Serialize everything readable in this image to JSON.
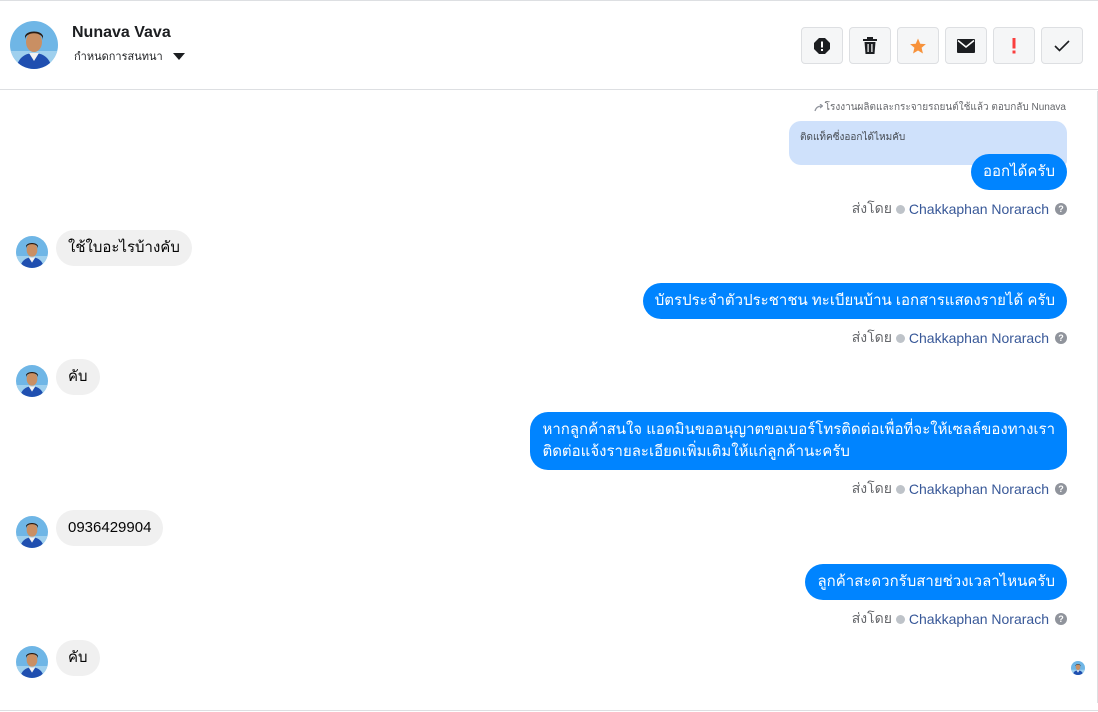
{
  "header": {
    "name": "Nunava Vava",
    "assign_label": "กำหนดการสนทนา",
    "toolbar": [
      {
        "name": "spam-icon"
      },
      {
        "name": "trash-icon"
      },
      {
        "name": "star-icon"
      },
      {
        "name": "envelope-icon"
      },
      {
        "name": "exclamation-icon"
      },
      {
        "name": "checkmark-icon"
      }
    ]
  },
  "colors": {
    "accent": "#0084ff",
    "star": "#f7923b",
    "exclaim": "#fa3e3e",
    "incoming": "#f0f0f0",
    "quoted": "#cfe1fb",
    "agent": "#385898"
  },
  "chat": {
    "reply_hint": "โรงงานผลิตและกระจายรถยนต์ใช้แล้ว ตอบกลับ Nunava",
    "quoted_text": "ติดแท็คซี่งออกได้ไหมคับ",
    "sent_prefix": "ส่งโดย",
    "agent_name": "Chakkaphan Norarach",
    "messages": [
      {
        "dir": "out",
        "text": "ออกได้ครับ"
      },
      {
        "dir": "in",
        "text": "ใช้ใบอะไรบ้างคับ"
      },
      {
        "dir": "out",
        "text": "บัตรประจำตัวประชาชน ทะเบียนบ้าน เอกสารแสดงรายได้ ครับ"
      },
      {
        "dir": "in",
        "text": "คับ"
      },
      {
        "dir": "out",
        "lines": [
          "หากลูกค้าสนใจ แอดมินขออนุญาตขอเบอร์โทรติดต่อเพื่อที่จะให้เซลล์ของทางเรา",
          "ติดต่อแจ้งรายละเอียดเพิ่มเติมให้แก่ลูกค้านะครับ"
        ]
      },
      {
        "dir": "in",
        "text": "0936429904"
      },
      {
        "dir": "out",
        "text": "ลูกค้าสะดวกรับสายช่วงเวลาไหนครับ"
      },
      {
        "dir": "in",
        "text": "คับ"
      }
    ]
  }
}
